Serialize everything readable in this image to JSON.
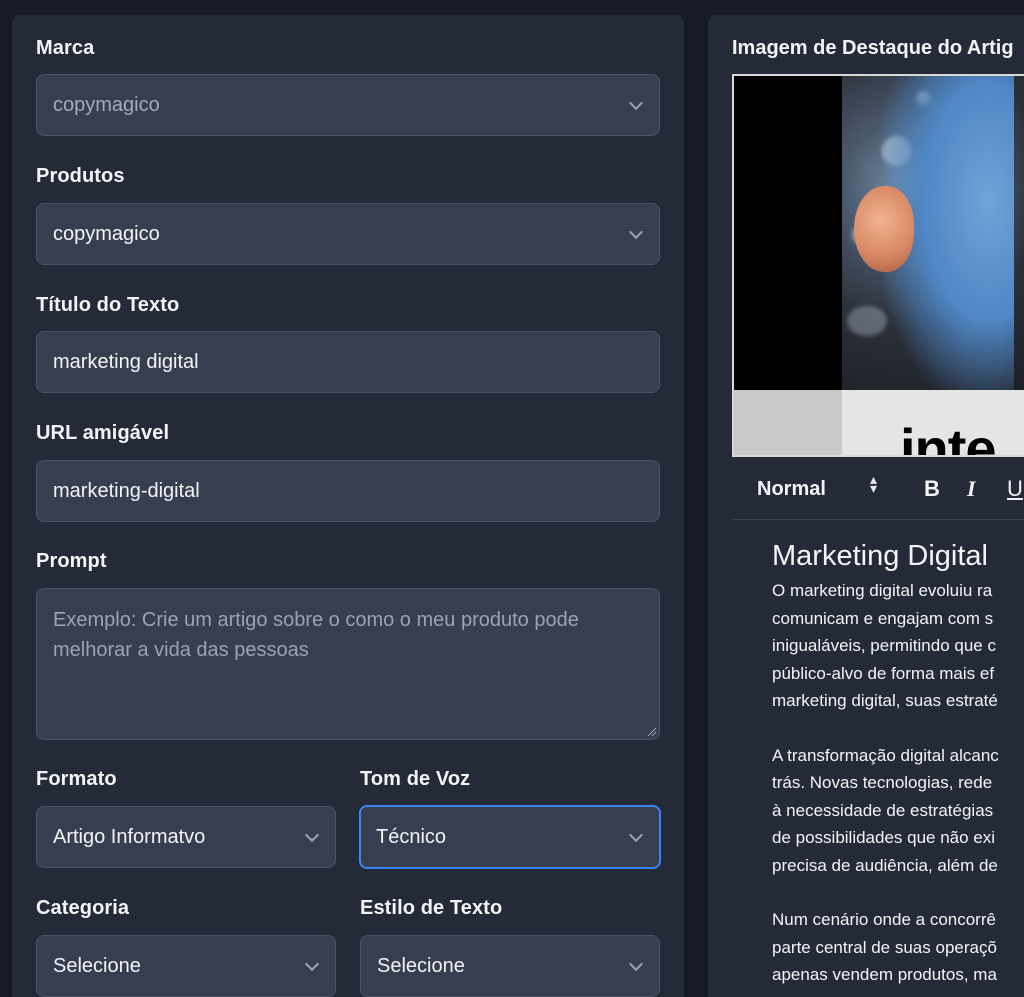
{
  "left": {
    "marca": {
      "label": "Marca",
      "value": "copymagico"
    },
    "produtos": {
      "label": "Produtos",
      "value": "copymagico"
    },
    "titulo": {
      "label": "Título do Texto",
      "value": "marketing digital"
    },
    "url": {
      "label": "URL amigável",
      "value": "marketing-digital"
    },
    "prompt": {
      "label": "Prompt",
      "placeholder": "Exemplo: Crie um artigo sobre o como o meu produto pode melhorar a vida das pessoas"
    },
    "formato": {
      "label": "Formato",
      "value": "Artigo Informatvo"
    },
    "tom": {
      "label": "Tom de Voz",
      "value": "Técnico"
    },
    "categoria": {
      "label": "Categoria",
      "value": "Selecione"
    },
    "estilo": {
      "label": "Estilo de Texto",
      "value": "Selecione"
    }
  },
  "right": {
    "image_title": "Imagem de Destaque do Artig",
    "image_caption_fragment": "inte",
    "toolbar": {
      "style_value": "Normal",
      "bold": "B",
      "italic": "I",
      "underline": "U"
    },
    "editor": {
      "heading": "Marketing Digital",
      "p1": [
        "O marketing digital evoluiu ra",
        "comunicam e engajam com s",
        "inigualáveis, permitindo que c",
        "público-alvo de forma mais ef",
        "marketing digital, suas estraté"
      ],
      "p2": [
        "A transformação digital alcanc",
        "trás. Novas tecnologias, rede",
        "à necessidade de estratégias",
        "de possibilidades que não exi",
        "precisa de audiência, além de"
      ],
      "p3": [
        "Num cenário onde a concorrê",
        "parte central de suas operaçõ",
        "apenas vendem produtos, ma"
      ]
    }
  },
  "colors": {
    "background": "#161b26",
    "panel": "#242a38",
    "field": "#373e4f",
    "focus": "#3b82f6"
  }
}
